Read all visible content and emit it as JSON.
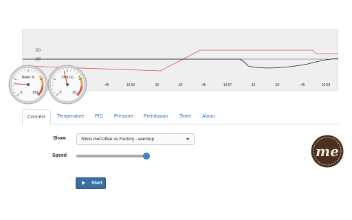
{
  "colors": {
    "panel_bg": "#efefef",
    "black_series": "#1a1a1a",
    "red_series": "#d9534f",
    "link": "#2a6db0",
    "button": "#3a6ea5",
    "slider_thumb": "#3f8ad3",
    "logo_brown": "#4a3020",
    "logo_cream": "#f2ead8"
  },
  "chart": {
    "y_ticks": [
      "110",
      "100"
    ],
    "x_ticks": [
      ":45",
      "10:56",
      ":15",
      ":30",
      ":45",
      "10:57",
      ":15",
      ":30",
      ":45",
      "10:58"
    ]
  },
  "gauges": [
    {
      "id": "boiler",
      "label": "Boiler %",
      "min": "0",
      "max": "100",
      "value_fraction": 0.18,
      "icon": "gauge-dial-icon"
    },
    {
      "id": "shot",
      "label": "Shot (s)",
      "min": "0",
      "max": "30",
      "value_fraction": 0.45,
      "icon": "gauge-dial-icon"
    }
  ],
  "tabs": [
    {
      "label": "Connect",
      "active": true
    },
    {
      "label": "Temperature",
      "active": false
    },
    {
      "label": "PID",
      "active": false
    },
    {
      "label": "Pressure",
      "active": false
    },
    {
      "label": "Preinfusion",
      "active": false
    },
    {
      "label": "Timer",
      "active": false
    },
    {
      "label": "About",
      "active": false
    }
  ],
  "form": {
    "show_label": "Show",
    "show_value": "Silvia meCoffee vs Factory - warmup",
    "speed_label": "Speed",
    "speed_fraction": 0.98
  },
  "start_button": {
    "label": "Start",
    "icon": "play-icon"
  },
  "logo": {
    "text": "me",
    "icon": "mecoffee-logo-icon"
  }
}
